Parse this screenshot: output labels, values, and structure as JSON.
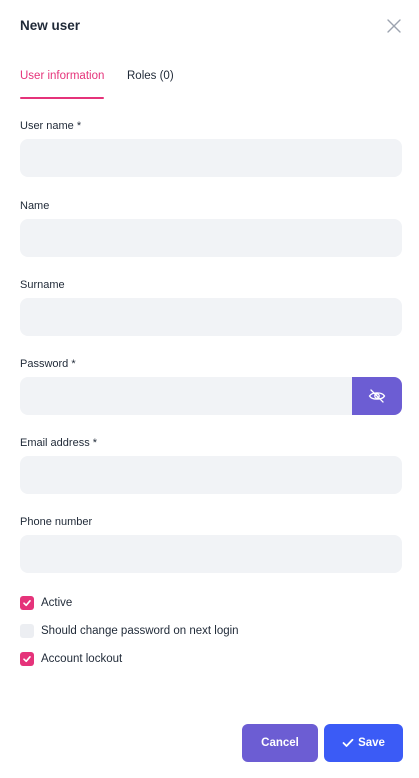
{
  "dialog": {
    "title": "New user",
    "close_icon": "close-icon"
  },
  "tabs": [
    {
      "label": "User information",
      "active": true
    },
    {
      "label": "Roles (0)",
      "active": false
    }
  ],
  "fields": {
    "username": {
      "label": "User name *",
      "value": ""
    },
    "name": {
      "label": "Name",
      "value": ""
    },
    "surname": {
      "label": "Surname",
      "value": ""
    },
    "password": {
      "label": "Password *",
      "value": "",
      "toggle_icon": "eye-off-icon"
    },
    "email": {
      "label": "Email address *",
      "value": ""
    },
    "phone": {
      "label": "Phone number",
      "value": ""
    }
  },
  "checkboxes": {
    "active": {
      "label": "Active",
      "checked": true
    },
    "change_password": {
      "label": "Should change password on next login",
      "checked": false
    },
    "lockout": {
      "label": "Account lockout",
      "checked": true
    }
  },
  "buttons": {
    "cancel": "Cancel",
    "save": "Save",
    "save_icon": "check-icon"
  },
  "colors": {
    "accent_pink": "#e5337a",
    "purple": "#6c5dd3",
    "blue": "#3b5bf6",
    "input_bg": "#f1f3f6"
  }
}
